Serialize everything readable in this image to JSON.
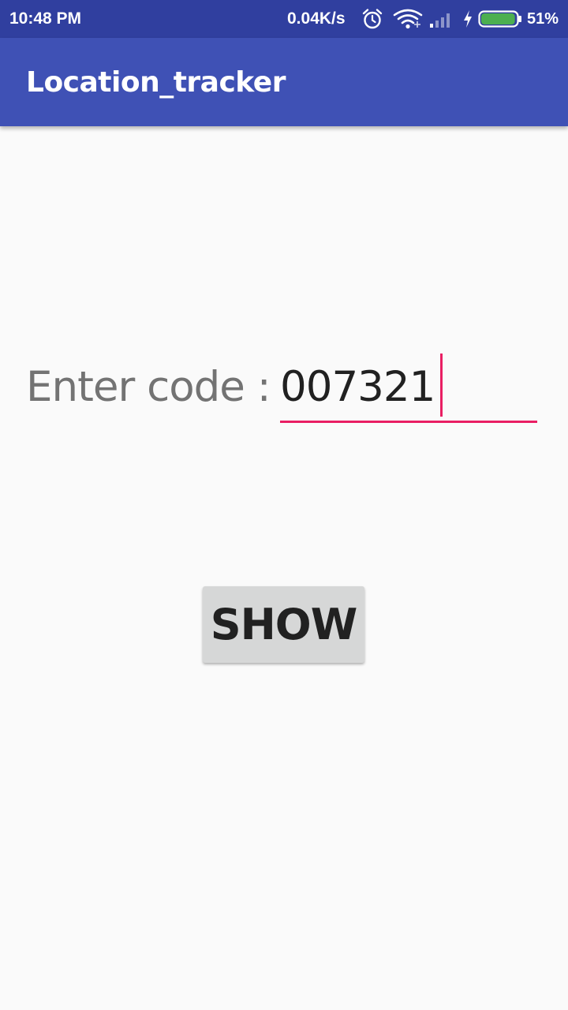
{
  "status_bar": {
    "time": "10:48 PM",
    "network_speed": "0.04K/s",
    "battery_percent": "51%",
    "battery_level": 0.51,
    "battery_color": "#4caf50",
    "icons": [
      "alarm-icon",
      "wifi-icon",
      "signal-icon",
      "charging-icon",
      "battery-icon"
    ],
    "background": "#303f9f"
  },
  "app_bar": {
    "title": "Location_tracker",
    "background": "#3f51b5"
  },
  "form": {
    "code_label": "Enter code :",
    "code_value": "007321",
    "accent_color": "#e91e63"
  },
  "actions": {
    "show_label": "SHOW"
  }
}
